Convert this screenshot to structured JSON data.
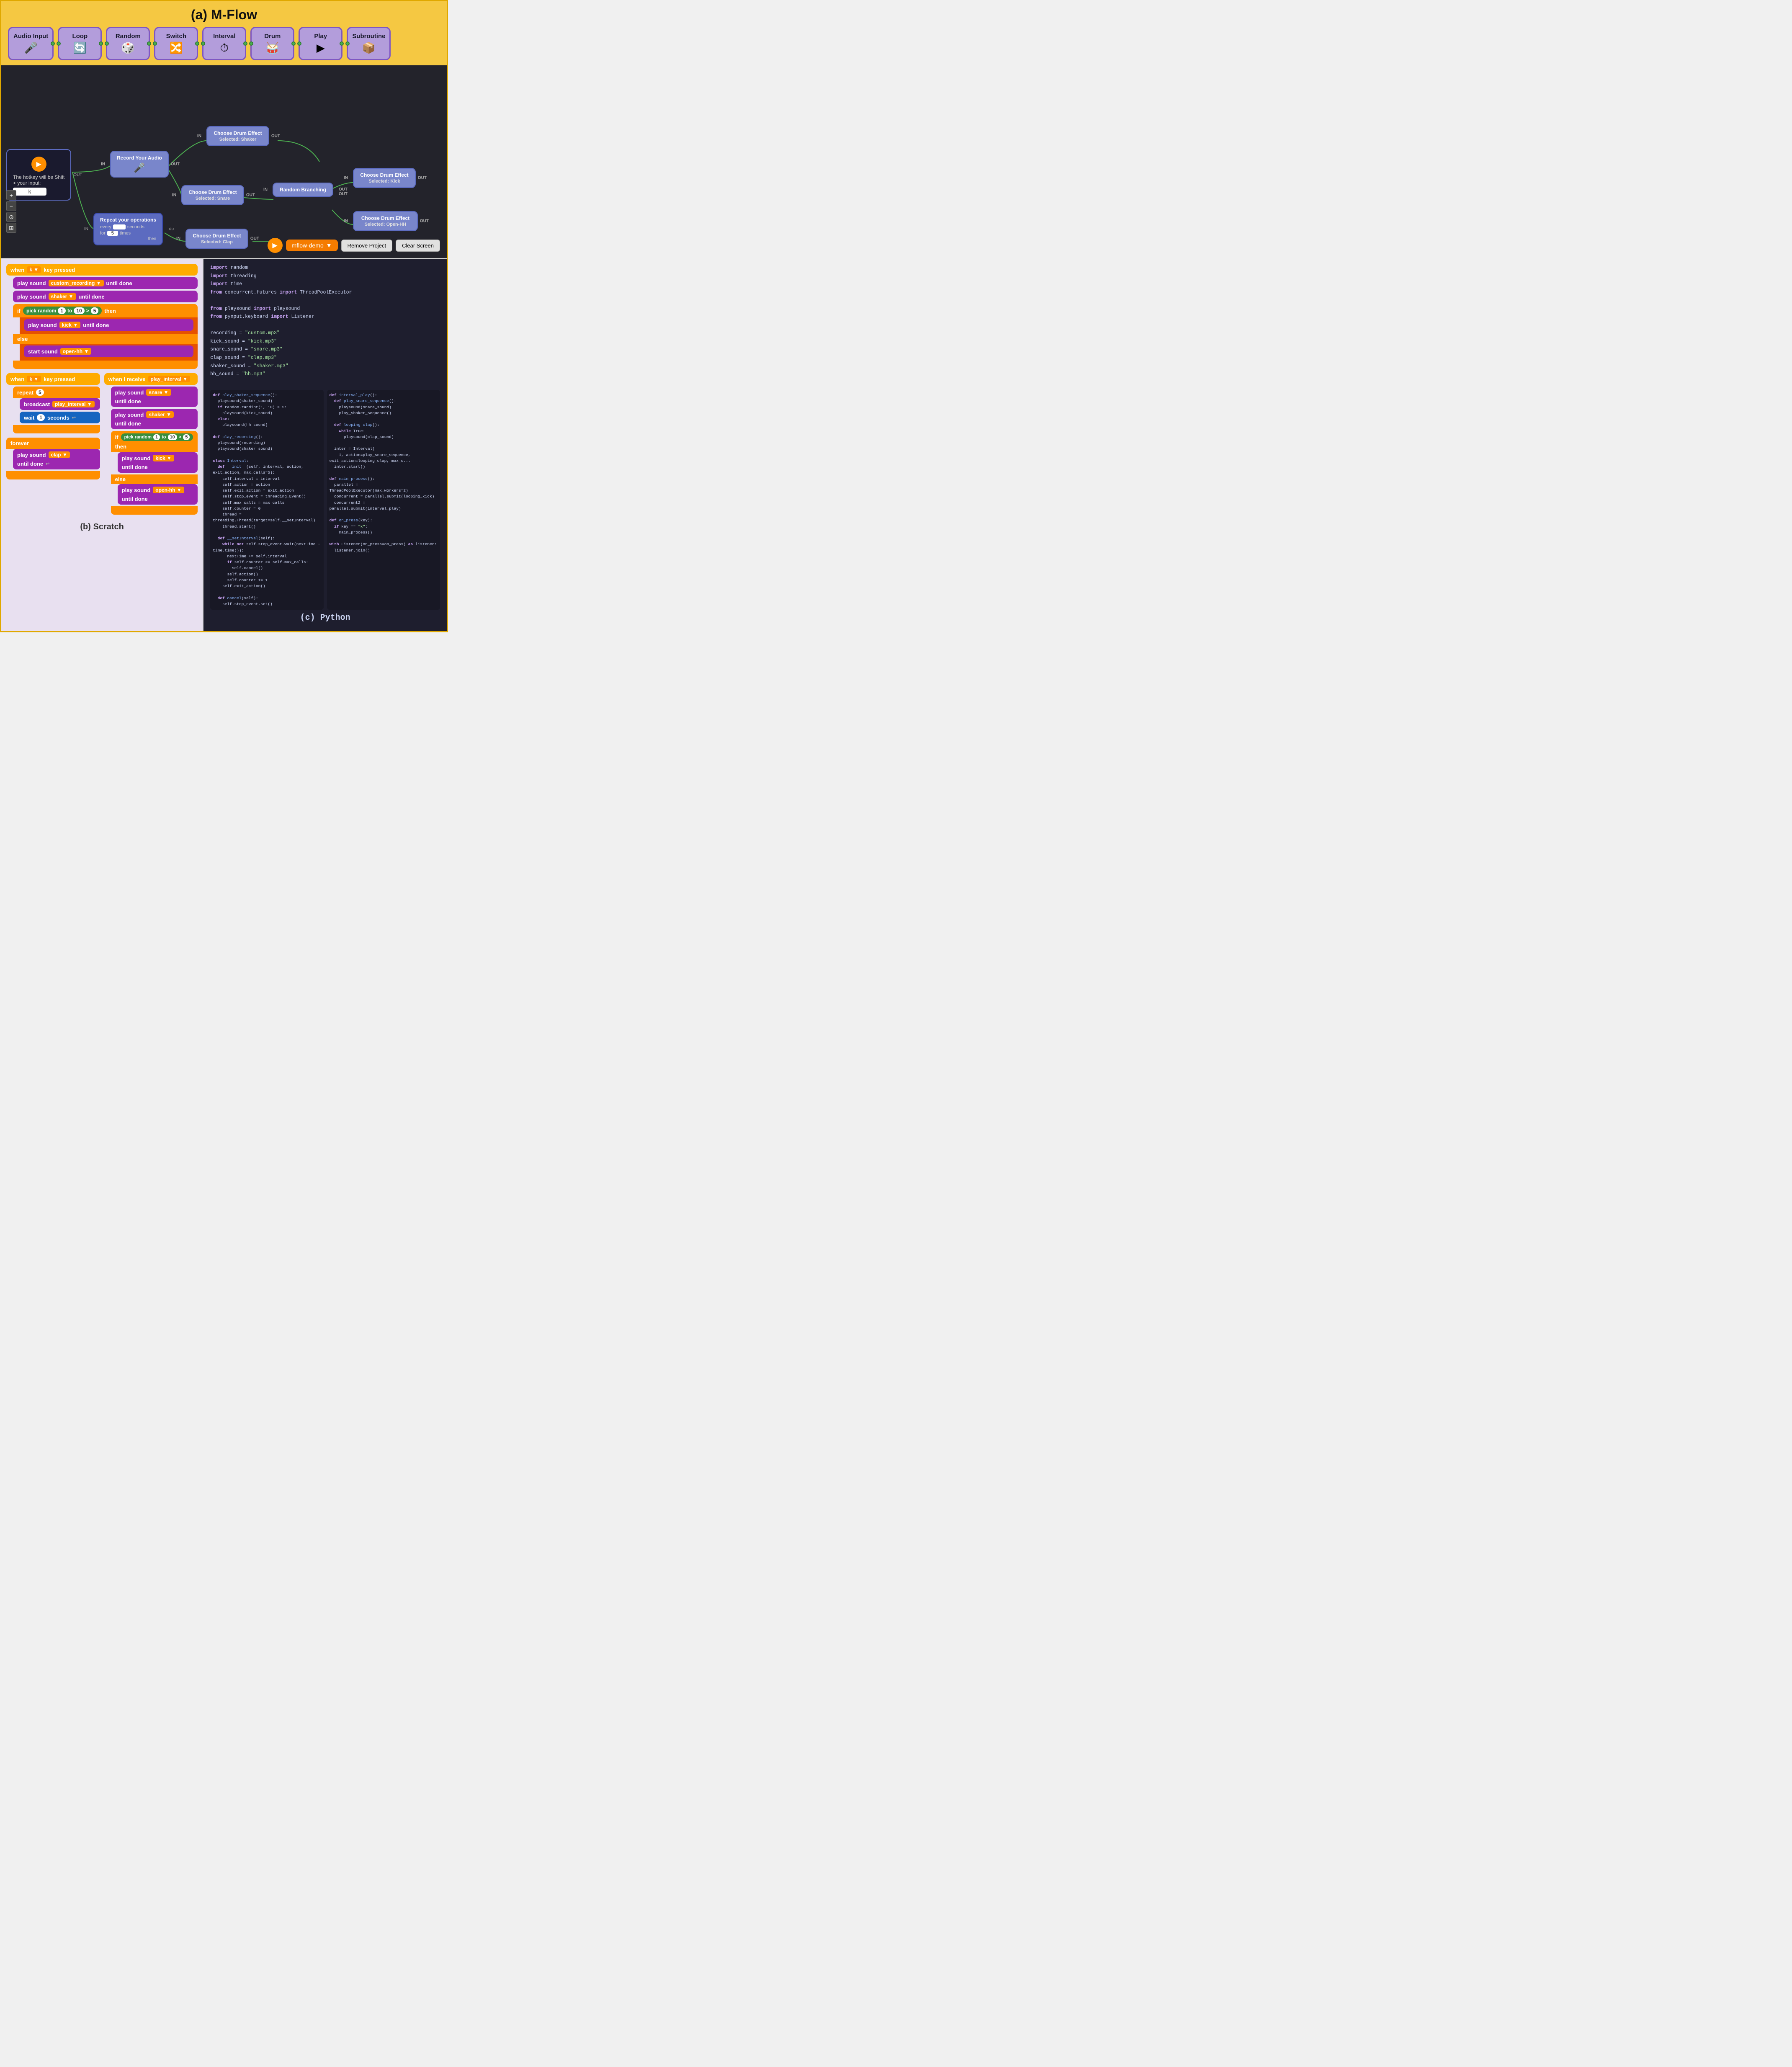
{
  "title": "(a) M-Flow",
  "toolbar": {
    "blocks": [
      {
        "label": "Audio Input",
        "icon": "🎤"
      },
      {
        "label": "Loop",
        "icon": "🔄"
      },
      {
        "label": "Random",
        "icon": "🎲"
      },
      {
        "label": "Switch",
        "icon": "🔀"
      },
      {
        "label": "Interval",
        "icon": "⏱"
      },
      {
        "label": "Drum",
        "icon": "🥁"
      },
      {
        "label": "Play",
        "icon": "▶"
      },
      {
        "label": "Subroutine",
        "icon": "📦"
      }
    ]
  },
  "canvas": {
    "nodes": [
      {
        "id": "drum1",
        "label": "Choose Drum Effect",
        "sub": "Selected: Shaker"
      },
      {
        "id": "record",
        "label": "Record Your Audio"
      },
      {
        "id": "drum2",
        "label": "Choose Drum Effect",
        "sub": "Selected: Snare"
      },
      {
        "id": "drum3",
        "label": "Choose Drum Effect",
        "sub": "Selected: Clap"
      },
      {
        "id": "drum4",
        "label": "Choose Drum Effect",
        "sub": "Selected: Kick"
      },
      {
        "id": "drum5",
        "label": "Choose Drum Effect",
        "sub": "Selected: Open-HH"
      },
      {
        "id": "random",
        "label": "Random Branching"
      },
      {
        "id": "play",
        "label": "The hotkey will be Shift + your input:",
        "hotkey": "k"
      },
      {
        "id": "interval",
        "label": "Repeat your operations",
        "detail": "every _ seconds\nfor 5 times"
      }
    ],
    "bottomBar": {
      "playBtn": "▶",
      "project": "mflow-demo",
      "removeLabel": "Remove Project",
      "clearLabel": "Clear Screen"
    }
  },
  "scratch": {
    "title": "(b) Scratch",
    "blocks": []
  },
  "python": {
    "title": "(c) Python",
    "code": [
      "import random",
      "import threading",
      "import time",
      "from concurrent.futures import ThreadPoolExecutor",
      "",
      "from playsound import playsound",
      "from pynput.keyboard import Listener",
      "",
      "recording = \"custom.mp3\"",
      "kick_sound = \"kick.mp3\"",
      "snare_sound = \"snare.mp3\"",
      "clap_sound = \"clap.mp3\"",
      "shaker_sound = \"shaker.mp3\"",
      "hh_sound = \"hh.mp3\""
    ]
  }
}
